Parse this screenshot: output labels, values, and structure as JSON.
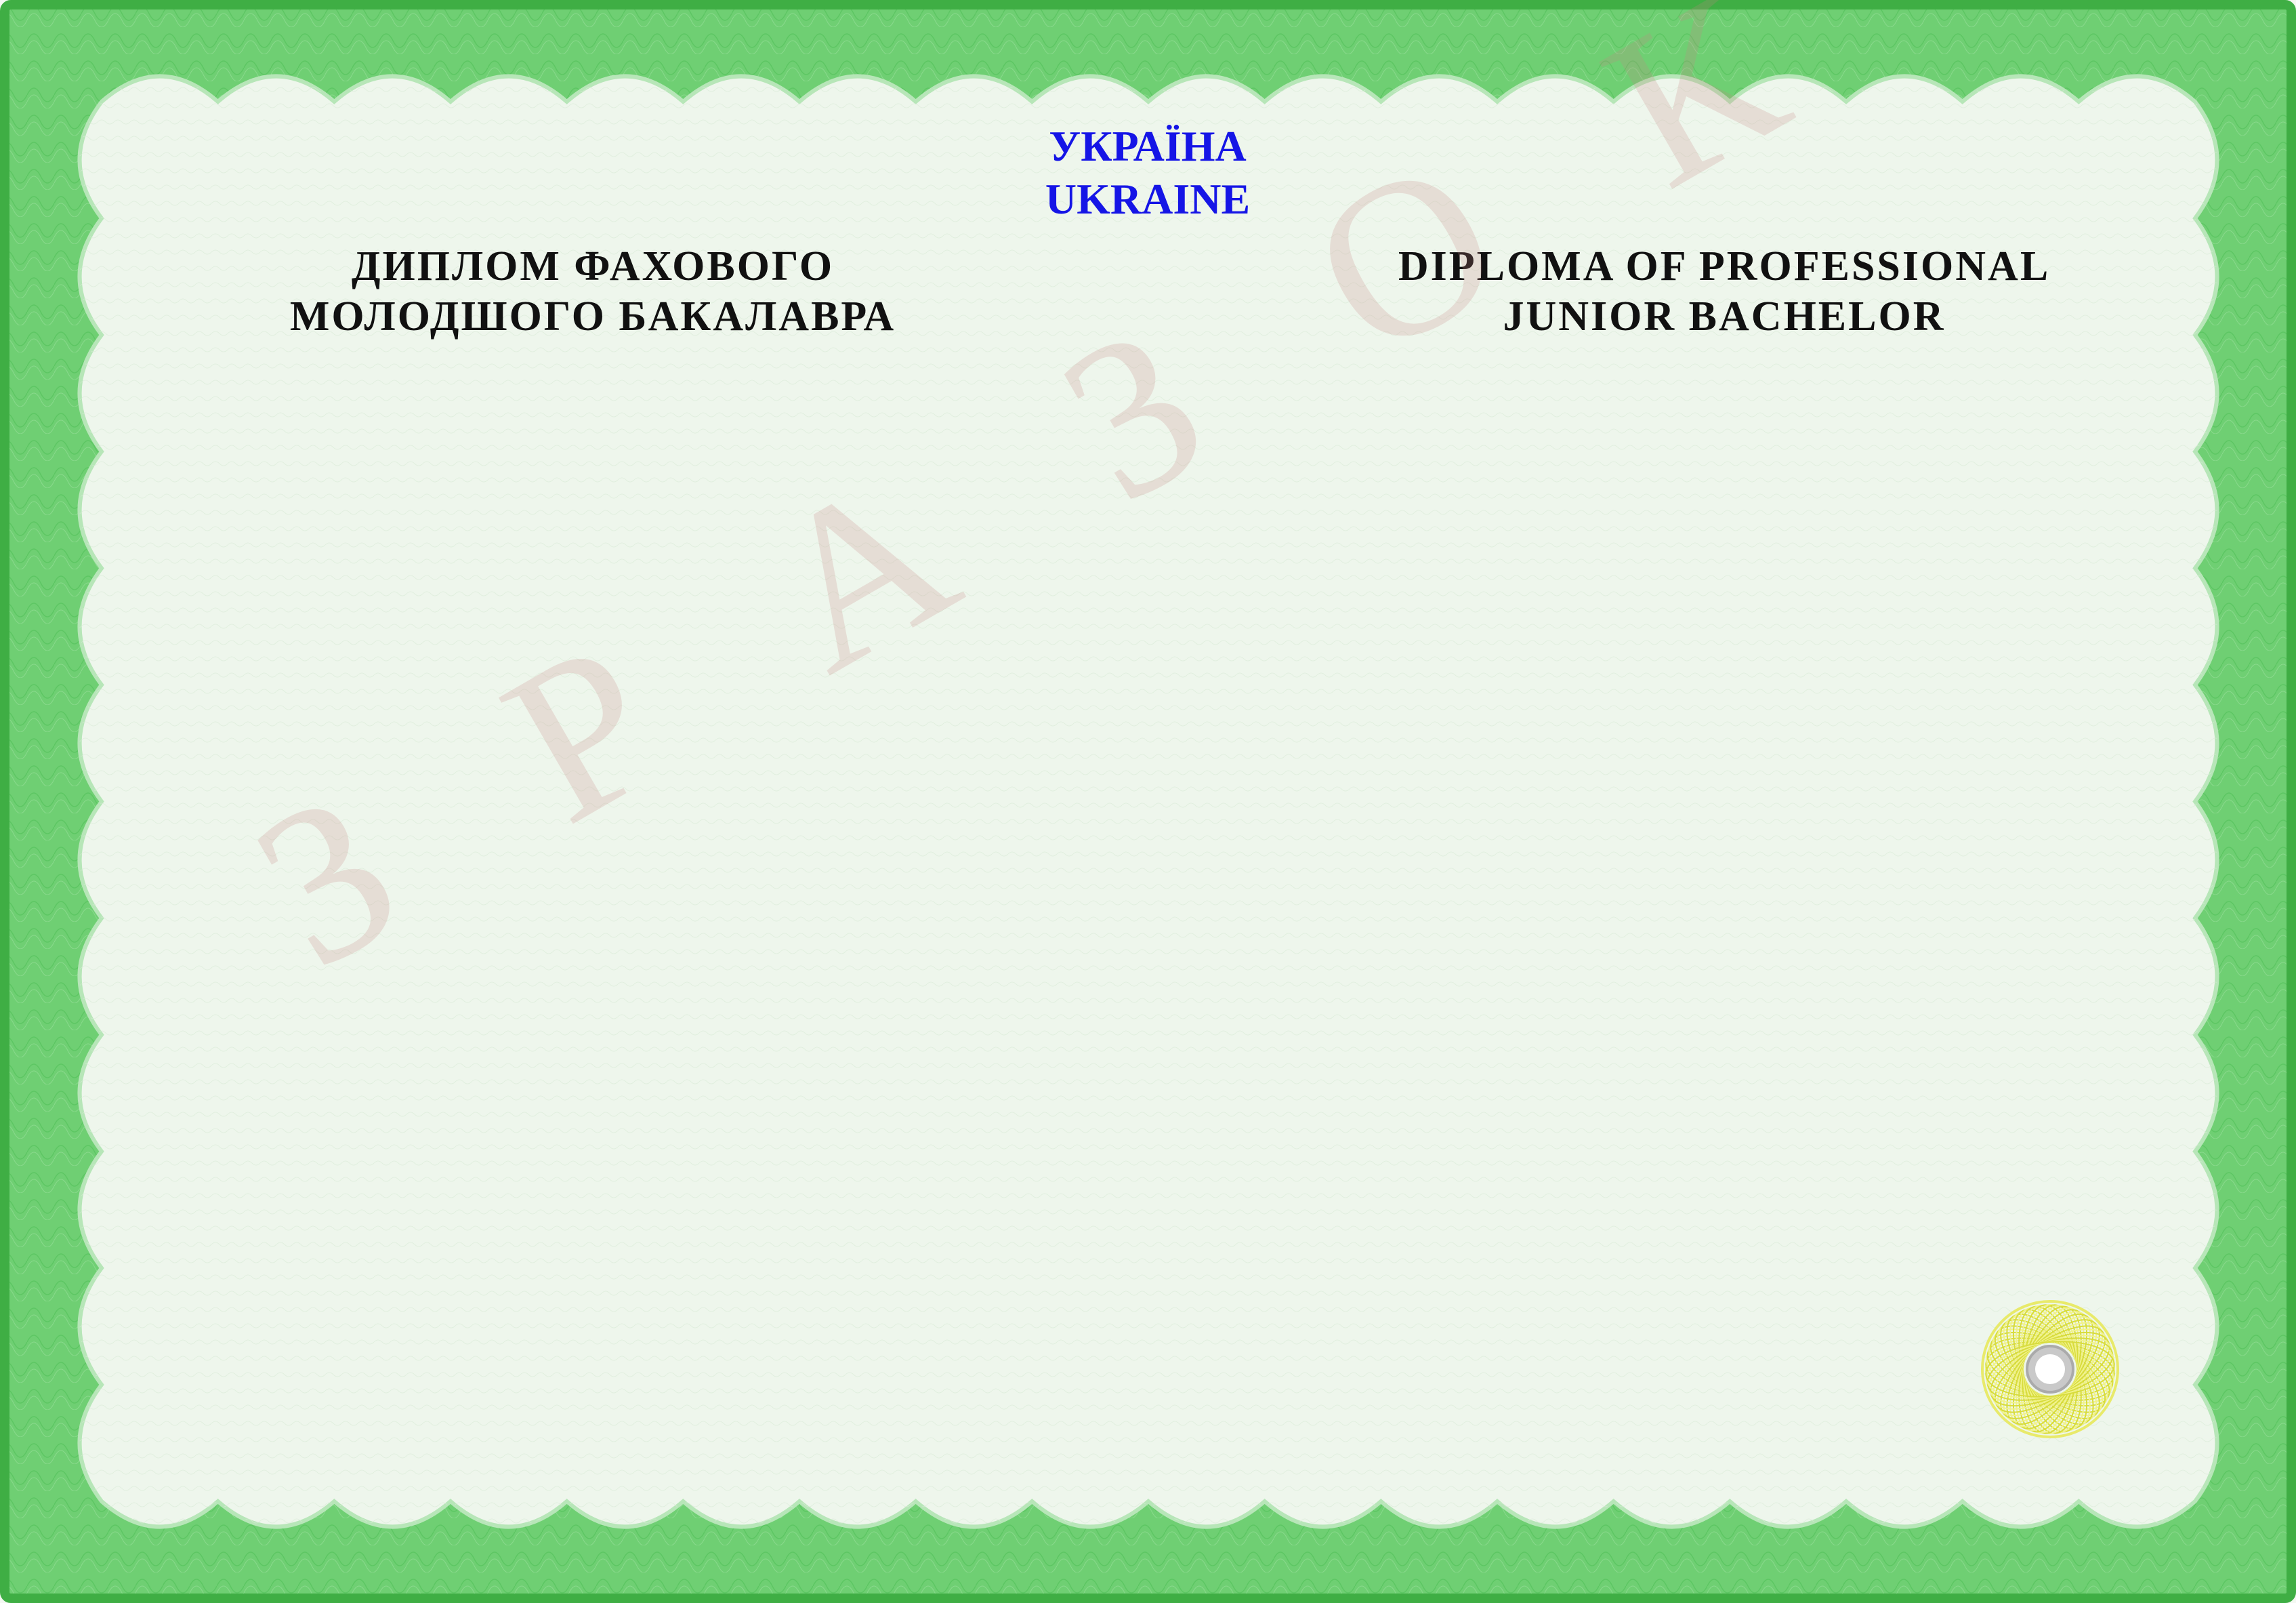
{
  "header": {
    "country_uk": "УКРАЇНА",
    "country_en": "UKRAINE"
  },
  "title_uk": {
    "line1": "ДИПЛОМ ФАХОВОГО",
    "line2": "МОЛОДШОГО БАКАЛАВРА"
  },
  "title_en": {
    "line1": "DIPLOMA OF PROFESSIONAL",
    "line2": "JUNIOR BACHELOR"
  },
  "watermark": {
    "text": "З Р А З О К"
  },
  "colors": {
    "frame_green": "#6fcf73",
    "frame_dark": "#3fae44",
    "paper": "#eef6ec",
    "country_text": "#1515e6",
    "title_text": "#111111",
    "watermark": "#c88282",
    "seal": "#e8ea6a"
  }
}
